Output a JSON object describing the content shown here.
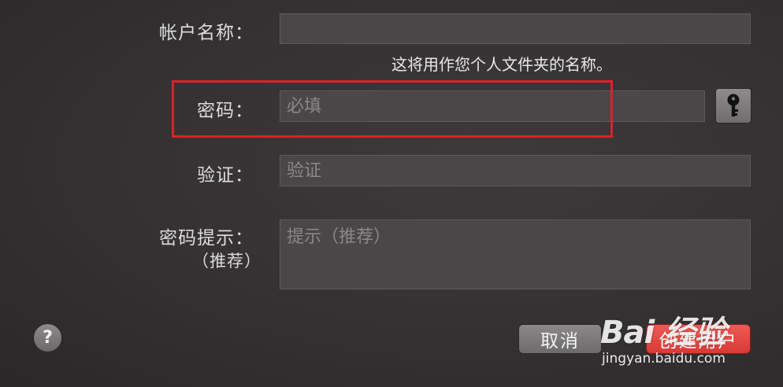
{
  "form": {
    "account_name": {
      "label": "帐户名称：",
      "value": "",
      "hint": "这将用作您个人文件夹的名称。"
    },
    "password": {
      "label": "密码：",
      "placeholder": "必填"
    },
    "verify": {
      "label": "验证：",
      "placeholder": "验证"
    },
    "password_hint": {
      "label": "密码提示：",
      "label_sub": "（推荐）",
      "placeholder": "提示（推荐）"
    }
  },
  "icons": {
    "key_button": "key-icon",
    "help_button": "question-mark-icon"
  },
  "buttons": {
    "help": "?",
    "cancel": "取消",
    "create": "创建用户"
  },
  "colors": {
    "highlight_box": "#d8232b",
    "primary_button": "#e04845"
  },
  "watermark": {
    "text": "Bai 经验",
    "url": "jingyan.baidu.com"
  }
}
